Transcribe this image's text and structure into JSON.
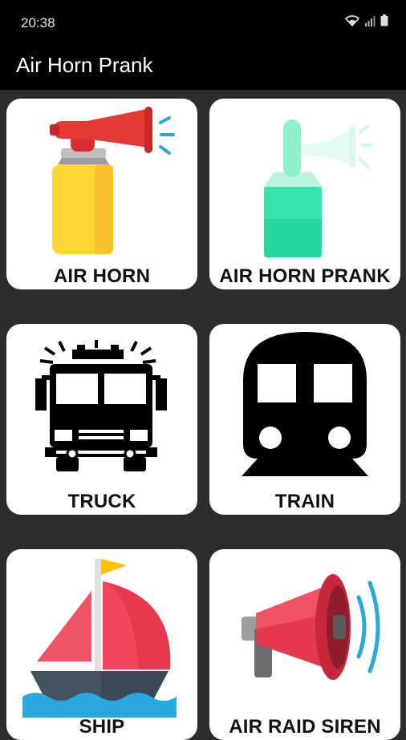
{
  "status_bar": {
    "time": "20:38",
    "icons": [
      "wifi-icon",
      "signal-icon",
      "battery-icon"
    ]
  },
  "app_bar": {
    "title": "Air Horn Prank"
  },
  "sounds": [
    {
      "label": "AIR HORN",
      "icon": "air-horn-icon"
    },
    {
      "label": "AIR HORN PRANK",
      "icon": "air-horn-prank-icon"
    },
    {
      "label": "TRUCK",
      "icon": "fire-truck-icon"
    },
    {
      "label": "TRAIN",
      "icon": "train-icon"
    },
    {
      "label": "SHIP",
      "icon": "sailboat-icon"
    },
    {
      "label": "AIR RAID SIREN",
      "icon": "megaphone-siren-icon"
    }
  ],
  "colors": {
    "background": "#2d2d2d",
    "app_bar": "#000000",
    "card": "#ffffff",
    "horn_red": "#e53935",
    "horn_yellow": "#fdd835",
    "prank_green": "#26d7a0"
  }
}
